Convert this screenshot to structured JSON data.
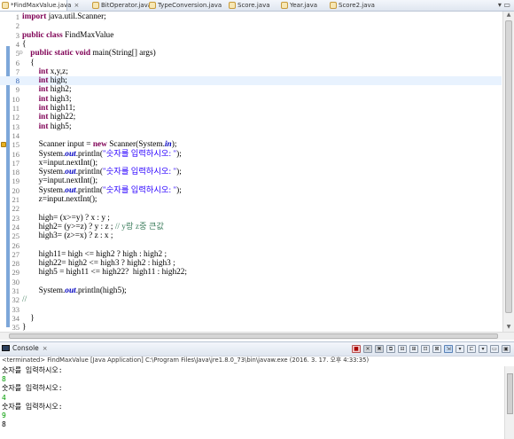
{
  "tabs": [
    {
      "label": "*FindMaxValue.java",
      "active": true
    },
    {
      "label": "BitOperator.java"
    },
    {
      "label": "TypeConversion.java"
    },
    {
      "label": "Score.java"
    },
    {
      "label": "Year.java"
    },
    {
      "label": "Score2.java"
    }
  ],
  "tab_close_glyph": "×",
  "tab_controls": "▾ ▭",
  "editor": {
    "current_line": 8,
    "lines": [
      {
        "n": "1",
        "tokens": [
          {
            "t": "import",
            "c": "kw"
          },
          {
            "t": " java.util.Scanner;"
          }
        ]
      },
      {
        "n": "2",
        "tokens": []
      },
      {
        "n": "3",
        "tokens": [
          {
            "t": "public",
            "c": "kw"
          },
          {
            "t": " "
          },
          {
            "t": "class",
            "c": "kw"
          },
          {
            "t": " FindMaxValue"
          }
        ]
      },
      {
        "n": "4",
        "tokens": [
          {
            "t": "{"
          }
        ]
      },
      {
        "n": "5",
        "fold": "⊖",
        "tokens": [
          {
            "t": "    "
          },
          {
            "t": "public",
            "c": "kw"
          },
          {
            "t": " "
          },
          {
            "t": "static",
            "c": "kw"
          },
          {
            "t": " "
          },
          {
            "t": "void",
            "c": "kw"
          },
          {
            "t": " main(String[] args)"
          }
        ]
      },
      {
        "n": "6",
        "tokens": [
          {
            "t": "    {"
          }
        ]
      },
      {
        "n": "7",
        "tokens": [
          {
            "t": "        "
          },
          {
            "t": "int",
            "c": "kw"
          },
          {
            "t": " x,y,z;"
          }
        ]
      },
      {
        "n": "8",
        "tokens": [
          {
            "t": "        "
          },
          {
            "t": "int",
            "c": "kw"
          },
          {
            "t": " high;"
          }
        ]
      },
      {
        "n": "9",
        "tokens": [
          {
            "t": "        "
          },
          {
            "t": "int",
            "c": "kw"
          },
          {
            "t": " high2;"
          }
        ]
      },
      {
        "n": "10",
        "tokens": [
          {
            "t": "        "
          },
          {
            "t": "int",
            "c": "kw"
          },
          {
            "t": " high3;"
          }
        ]
      },
      {
        "n": "11",
        "tokens": [
          {
            "t": "        "
          },
          {
            "t": "int",
            "c": "kw"
          },
          {
            "t": " high11;"
          }
        ]
      },
      {
        "n": "12",
        "tokens": [
          {
            "t": "        "
          },
          {
            "t": "int",
            "c": "kw"
          },
          {
            "t": " high22;"
          }
        ]
      },
      {
        "n": "13",
        "tokens": [
          {
            "t": "        "
          },
          {
            "t": "int",
            "c": "kw"
          },
          {
            "t": " high5;"
          }
        ]
      },
      {
        "n": "14",
        "tokens": []
      },
      {
        "n": "15",
        "warn": true,
        "tokens": [
          {
            "t": "        Scanner input = "
          },
          {
            "t": "new",
            "c": "kw"
          },
          {
            "t": " Scanner(System."
          },
          {
            "t": "in",
            "c": "fld"
          },
          {
            "t": ");"
          }
        ]
      },
      {
        "n": "16",
        "tokens": [
          {
            "t": "        System."
          },
          {
            "t": "out",
            "c": "fld"
          },
          {
            "t": ".println("
          },
          {
            "t": "\"숫자를 입력하시오: \"",
            "c": "str"
          },
          {
            "t": ");"
          }
        ]
      },
      {
        "n": "17",
        "tokens": [
          {
            "t": "        x=input.nextInt();"
          }
        ]
      },
      {
        "n": "18",
        "tokens": [
          {
            "t": "        System."
          },
          {
            "t": "out",
            "c": "fld"
          },
          {
            "t": ".println("
          },
          {
            "t": "\"숫자를 입력하시오: \"",
            "c": "str"
          },
          {
            "t": ");"
          }
        ]
      },
      {
        "n": "19",
        "tokens": [
          {
            "t": "        y=input.nextInt();"
          }
        ]
      },
      {
        "n": "20",
        "tokens": [
          {
            "t": "        System."
          },
          {
            "t": "out",
            "c": "fld"
          },
          {
            "t": ".println("
          },
          {
            "t": "\"숫자를 입력하시오: \"",
            "c": "str"
          },
          {
            "t": ");"
          }
        ]
      },
      {
        "n": "21",
        "tokens": [
          {
            "t": "        z=input.nextInt();"
          }
        ]
      },
      {
        "n": "22",
        "tokens": []
      },
      {
        "n": "23",
        "tokens": [
          {
            "t": "        high= (x>=y) ? x : y ;"
          }
        ]
      },
      {
        "n": "24",
        "tokens": [
          {
            "t": "        high2= (y>=z) ? y : z ; "
          },
          {
            "t": "// y랑 z중 큰값",
            "c": "cmt"
          }
        ]
      },
      {
        "n": "25",
        "tokens": [
          {
            "t": "        high3= (z>=x) ? z : x ;"
          }
        ]
      },
      {
        "n": "26",
        "tokens": []
      },
      {
        "n": "27",
        "tokens": [
          {
            "t": "        high11= high <= high2 ? high : high2 ;"
          }
        ]
      },
      {
        "n": "28",
        "tokens": [
          {
            "t": "        high22= high2 <= high3 ? high2 : high3 ;"
          }
        ]
      },
      {
        "n": "29",
        "tokens": [
          {
            "t": "        high5 = high11 <= high22?  high11 : high22;"
          }
        ]
      },
      {
        "n": "30",
        "tokens": []
      },
      {
        "n": "31",
        "tokens": [
          {
            "t": "        System."
          },
          {
            "t": "out",
            "c": "fld"
          },
          {
            "t": ".println(high5);"
          }
        ]
      },
      {
        "n": "32",
        "tokens": [
          {
            "t": "//",
            "c": "cmt"
          }
        ]
      },
      {
        "n": "33",
        "tokens": []
      },
      {
        "n": "34",
        "tokens": [
          {
            "t": "    }"
          }
        ]
      },
      {
        "n": "35",
        "tokens": [
          {
            "t": "}"
          }
        ]
      }
    ]
  },
  "console": {
    "tab_label": "Console",
    "tab_close_glyph": "×",
    "tool_glyphs": [
      "■",
      "✕",
      "✖",
      "⧉",
      "⊟",
      "⊞",
      "⊡",
      "⊠",
      "⇲",
      "▾",
      "⊏",
      "▾",
      "▭",
      "▣"
    ],
    "status": "<terminated> FindMaxValue [Java Application] C:\\Program Files\\Java\\jre1.8.0_73\\bin\\javaw.exe (2016. 3. 17. 오후 4:33:35)",
    "lines": [
      {
        "text": "숫자를 입력하시오:",
        "type": "out"
      },
      {
        "text": "8",
        "type": "input"
      },
      {
        "text": "숫자를 입력하시오:",
        "type": "out"
      },
      {
        "text": "4",
        "type": "input"
      },
      {
        "text": "숫자를 입력하시오:",
        "type": "out"
      },
      {
        "text": "9",
        "type": "input"
      },
      {
        "text": "8",
        "type": "out"
      }
    ]
  },
  "colors": {
    "keyword": "#7f0055",
    "string": "#2a00ff",
    "comment": "#3f7f5f",
    "field": "#0000c0",
    "console_input": "#009c00",
    "current_line": "#e8f2fe"
  }
}
